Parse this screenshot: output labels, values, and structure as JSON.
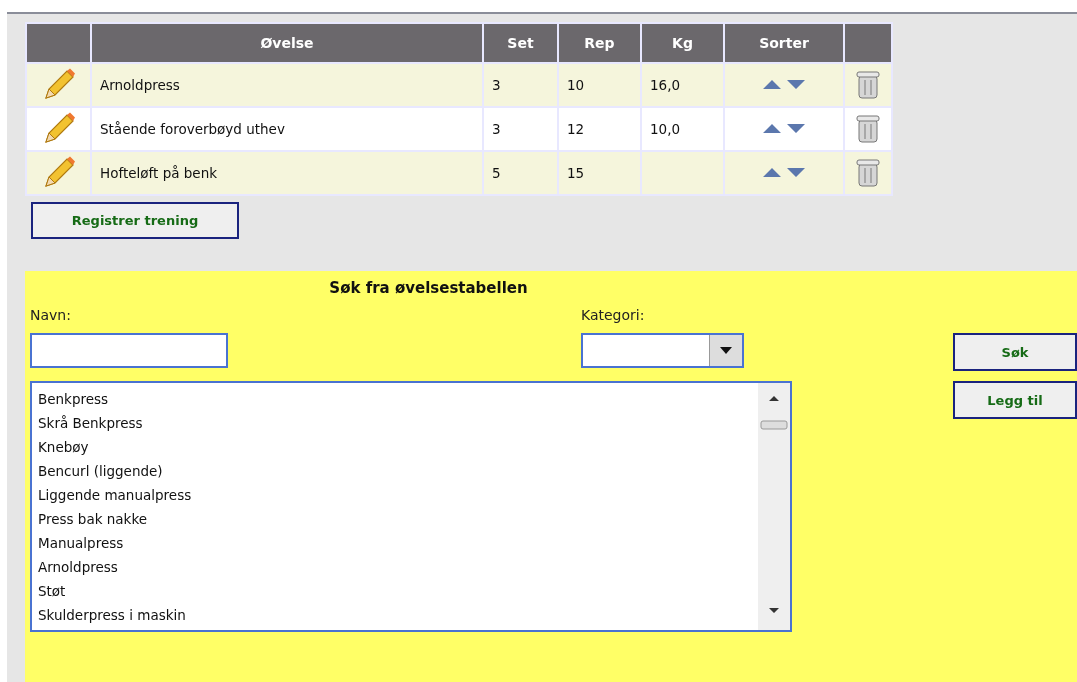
{
  "table": {
    "columns": [
      "Øvelse",
      "Set",
      "Rep",
      "Kg",
      "Sorter"
    ],
    "rows": [
      {
        "exercise": "Arnoldpress",
        "set": "3",
        "rep": "10",
        "kg": "16,0"
      },
      {
        "exercise": "Stående foroverbøyd uthev",
        "set": "3",
        "rep": "12",
        "kg": "10,0"
      },
      {
        "exercise": "Hofteløft på benk",
        "set": "5",
        "rep": "15",
        "kg": ""
      }
    ]
  },
  "register_button": "Registrer trening",
  "search_panel": {
    "title": "Søk fra øvelsestabellen",
    "name_label": "Navn:",
    "category_label": "Kategori:",
    "exercises": [
      "Benkpress",
      "Skrå Benkpress",
      "Knebøy",
      "Bencurl (liggende)",
      "Liggende manualpress",
      "Press bak nakke",
      "Manualpress",
      "Arnoldpress",
      "Støt",
      "Skulderpress i maskin"
    ],
    "buttons": [
      "Søk",
      "Legg til"
    ]
  }
}
